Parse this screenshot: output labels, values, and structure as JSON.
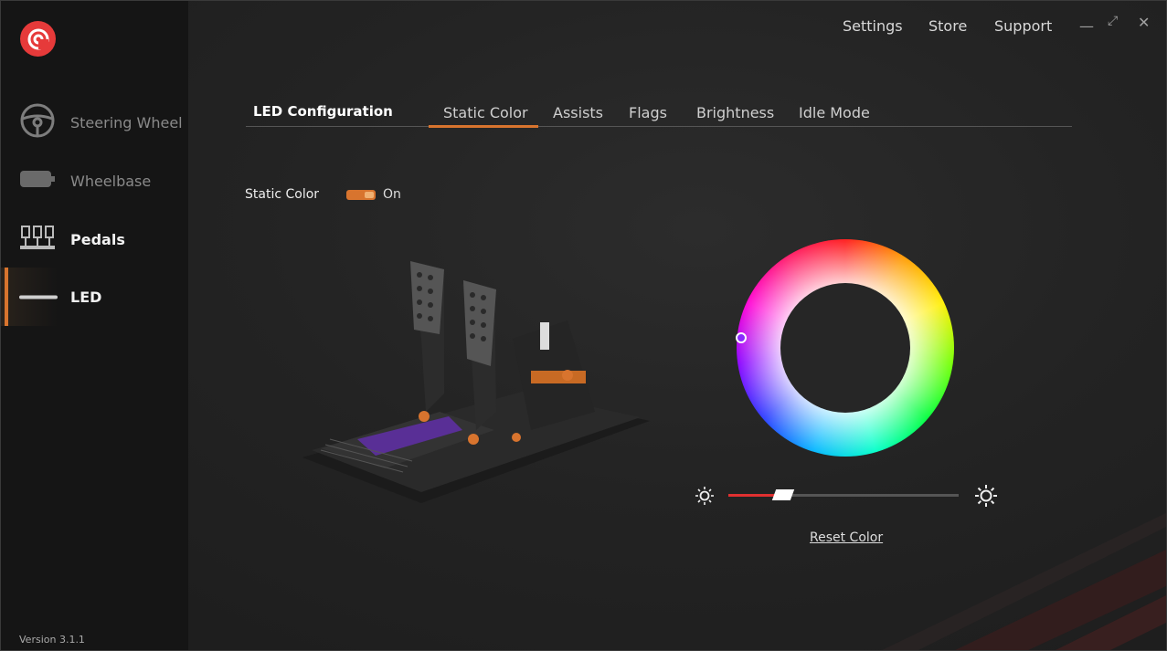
{
  "topmenu": {
    "settings": "Settings",
    "store": "Store",
    "support": "Support"
  },
  "window": {
    "minimize": "—",
    "maximize": "⤢",
    "close": "✕"
  },
  "sidebar": {
    "items": [
      {
        "label": "Steering Wheel",
        "icon": "steering-wheel-icon"
      },
      {
        "label": "Wheelbase",
        "icon": "wheelbase-icon"
      },
      {
        "label": "Pedals",
        "icon": "pedals-icon"
      },
      {
        "label": "LED",
        "icon": "led-icon"
      }
    ],
    "active": "LED",
    "version": "Version 3.1.1"
  },
  "main": {
    "section_title": "LED Configuration",
    "tabs": [
      "Static Color",
      "Assists",
      "Flags",
      "Brightness",
      "Idle Mode"
    ],
    "active_tab": "Static Color",
    "static_color": {
      "label": "Static Color",
      "state": "On",
      "enabled": true
    },
    "brightness_level": 0.24,
    "reset_label": "Reset Color",
    "accent_color": "#d8742e",
    "selected_color": "#8a2bff"
  }
}
